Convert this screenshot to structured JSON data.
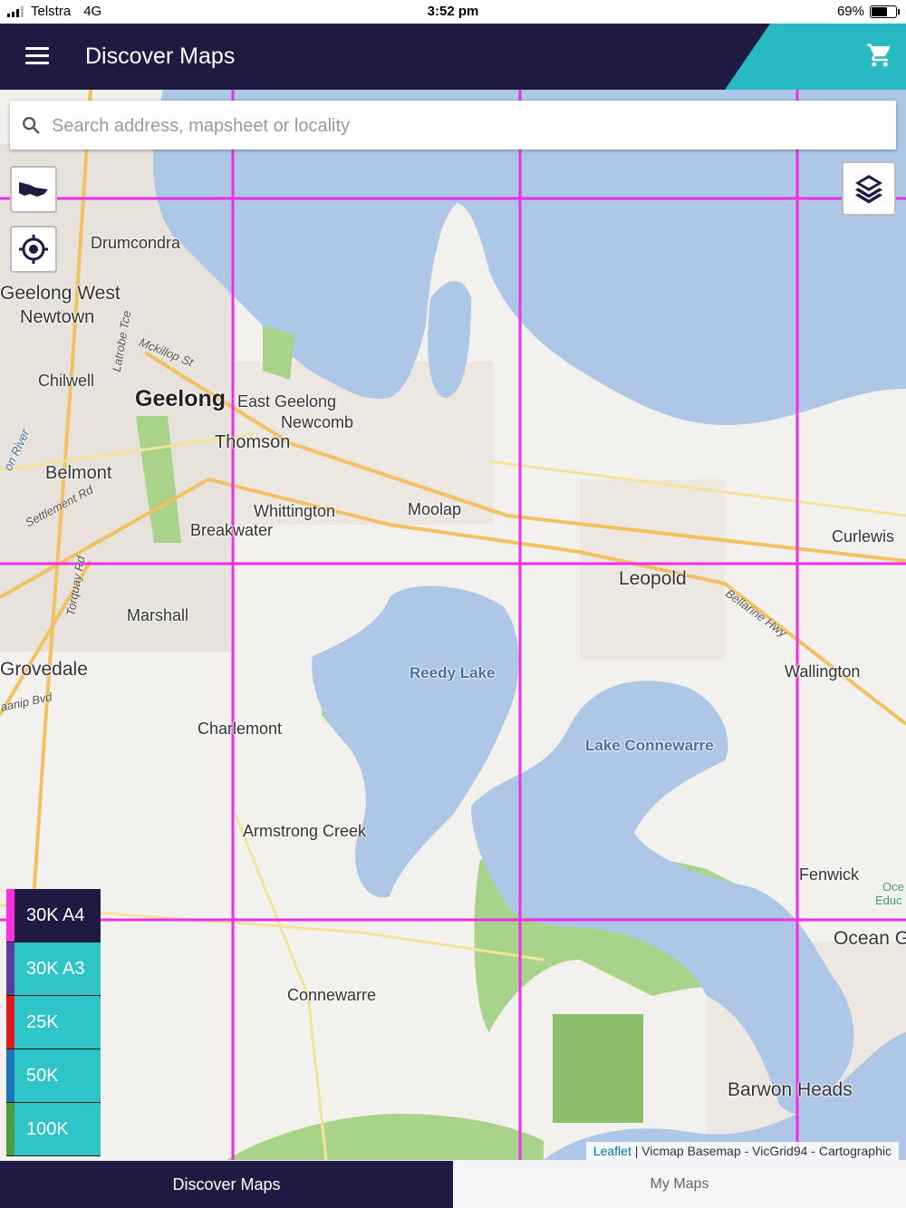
{
  "status_bar": {
    "carrier": "Telstra",
    "network": "4G",
    "time": "3:52 pm",
    "battery": "69%",
    "battery_level": 0.69
  },
  "header": {
    "title": "Discover Maps",
    "menu_icon": "hamburger-menu-icon",
    "cart_icon": "shopping-cart-icon"
  },
  "search": {
    "placeholder": "Search address, mapsheet or locality"
  },
  "map_buttons": {
    "victoria": "victoria-outline-icon",
    "locate": "crosshair-locate-icon",
    "layers": "layers-icon"
  },
  "places": {
    "drumcondra": "Drumcondra",
    "geelong_west": "Geelong West",
    "newtown": "Newtown",
    "chilwell": "Chilwell",
    "geelong": "Geelong",
    "east_geelong": "East Geelong",
    "newcomb": "Newcomb",
    "thomson": "Thomson",
    "belmont": "Belmont",
    "whittington": "Whittington",
    "breakwater": "Breakwater",
    "moolap": "Moolap",
    "curlewis": "Curlewis",
    "leopold": "Leopold",
    "marshall": "Marshall",
    "grovedale": "Grovedale",
    "charlemont": "Charlemont",
    "reedy_lake": "Reedy Lake",
    "lake_connewarre": "Lake Connewarre",
    "wallington": "Wallington",
    "armstrong_creek": "Armstrong Creek",
    "fenwick": "Fenwick",
    "connewarre": "Connewarre",
    "ocean_grove": "Ocean G",
    "barwon_heads": "Barwon Heads",
    "ocean_edu_1": "Oce",
    "ocean_edu_2": "Educ"
  },
  "roads": {
    "mckillop": "Mckillop St",
    "latrobe": "Latrobe Tce",
    "settlement": "Settlement Rd",
    "torquay": "Torquay Rd",
    "bellarine": "Bellarine Hwy",
    "barwon_river": "on River",
    "baanip": "aanip Bvd"
  },
  "scales": [
    {
      "label": "30K A4",
      "color": "#ff2ee0",
      "selected": true
    },
    {
      "label": "30K A3",
      "color": "#5b3d9a",
      "selected": false
    },
    {
      "label": "25K",
      "color": "#e01b1b",
      "selected": false
    },
    {
      "label": "50K",
      "color": "#1c73b5",
      "selected": false
    },
    {
      "label": "100K",
      "color": "#4f9a3a",
      "selected": false
    }
  ],
  "attribution": {
    "leaflet": "Leaflet",
    "text": "| Vicmap Basemap - VicGrid94 - Cartographic"
  },
  "tabs": [
    {
      "label": "Discover Maps",
      "active": true
    },
    {
      "label": "My Maps",
      "active": false
    }
  ],
  "colors": {
    "header": "#1f1a42",
    "accent": "#29b9c2",
    "grid": "#ee2ee6",
    "water": "#aec7e6",
    "park": "#a9d38a"
  }
}
